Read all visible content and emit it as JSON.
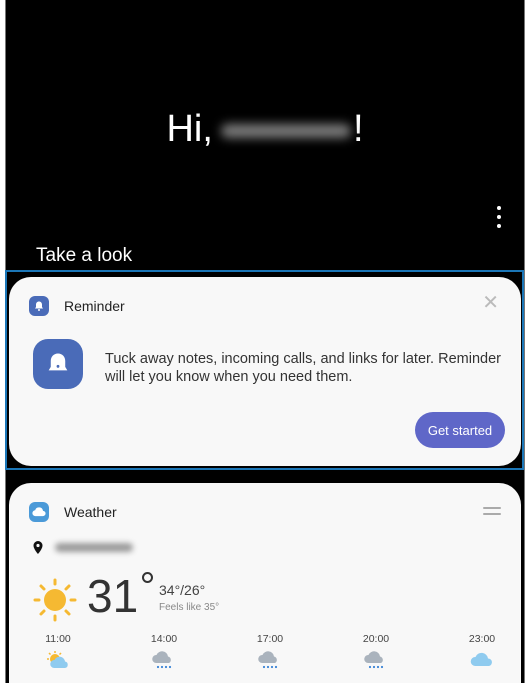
{
  "greeting": {
    "prefix": "Hi,",
    "suffix": "!"
  },
  "section_title": "Take a look",
  "reminder_card": {
    "app_name": "Reminder",
    "close_glyph": "✕",
    "message": "Tuck away notes, incoming calls, and links for later. Reminder will let you know when you need them.",
    "button_label": "Get started",
    "icon": "bell-icon",
    "accent": "#5f67c8"
  },
  "weather_card": {
    "app_name": "Weather",
    "icon": "cloud-icon",
    "temperature": "31",
    "high_low": "34°/26°",
    "feels_like": "Feels like 35°",
    "hourly": [
      {
        "time": "11:00",
        "icon": "partly-sunny-icon"
      },
      {
        "time": "14:00",
        "icon": "rain-icon"
      },
      {
        "time": "17:00",
        "icon": "rain-icon"
      },
      {
        "time": "20:00",
        "icon": "rain-icon"
      },
      {
        "time": "23:00",
        "icon": "cloud-icon"
      }
    ]
  }
}
